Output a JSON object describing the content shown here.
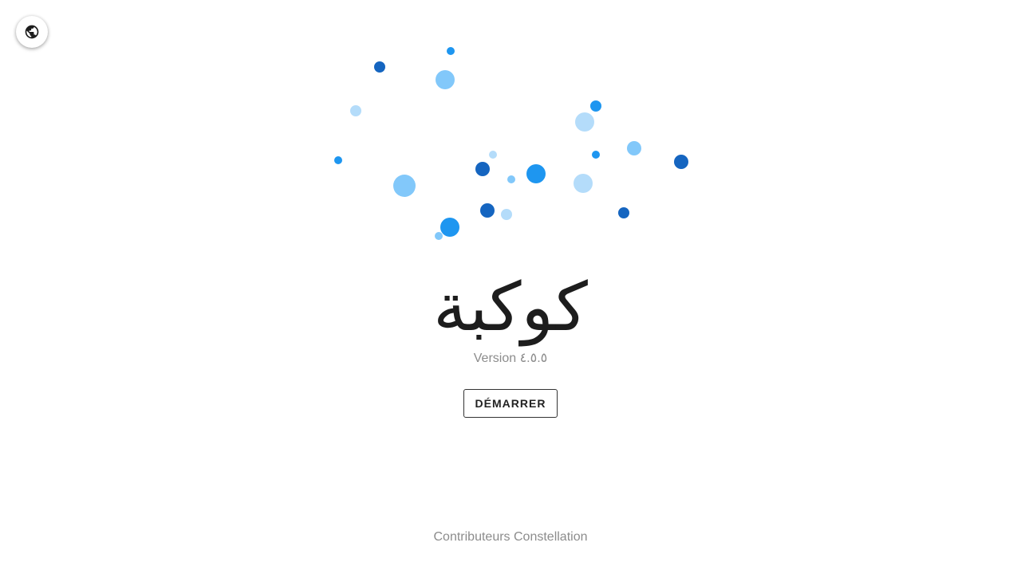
{
  "language_button": {
    "icon": "globe-icon"
  },
  "logo": {
    "dot_colors": {
      "dark": "#1565c0",
      "medium": "#1e96f0",
      "light": "#82c8fa",
      "pale": "#b4dcfa"
    }
  },
  "app": {
    "title": "كوكبة",
    "version": "Version ٤.٥.٥"
  },
  "actions": {
    "start_label": "DÉMARRER"
  },
  "footer": {
    "credits": "Contributeurs Constellation"
  }
}
